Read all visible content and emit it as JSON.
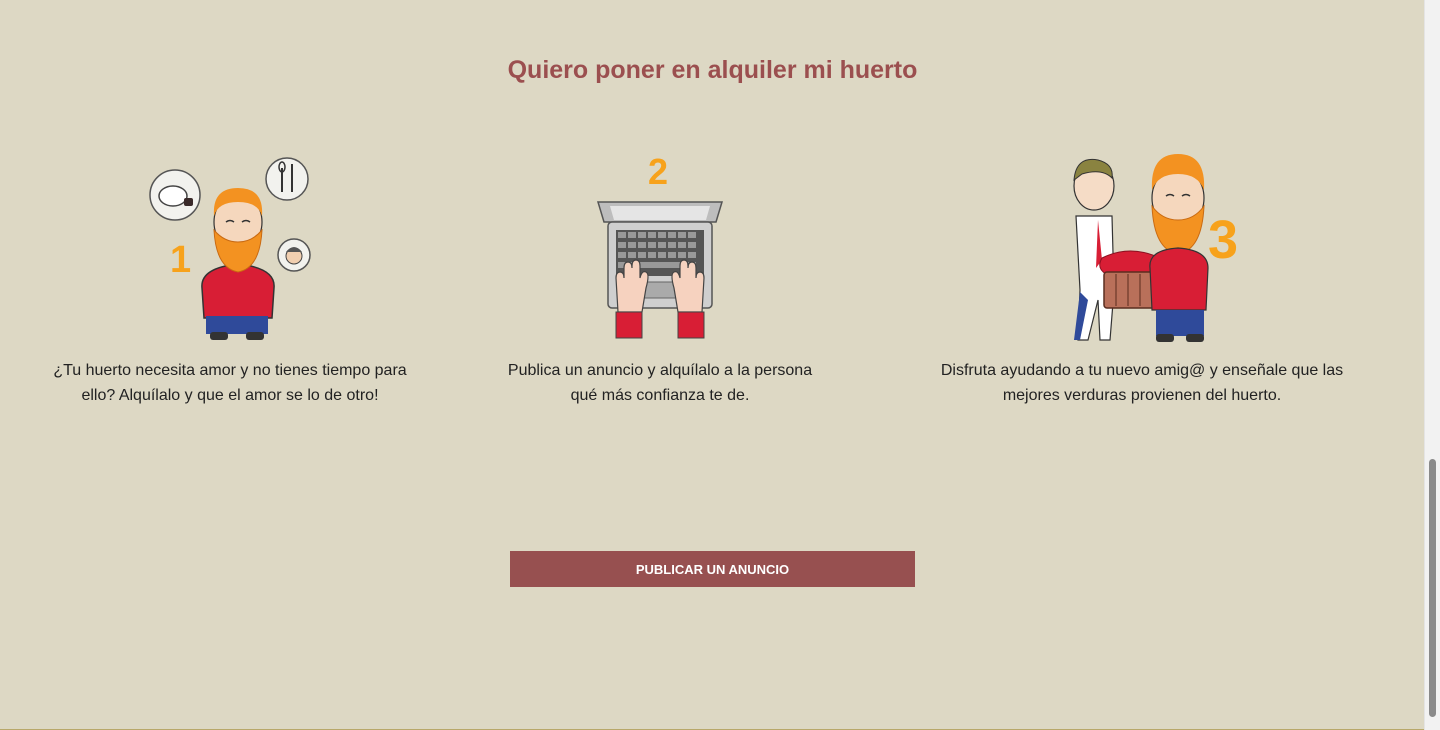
{
  "section": {
    "title": "Quiero poner en alquiler mi huerto"
  },
  "steps": [
    {
      "number": "1",
      "text_line1": "¿Tu huerto necesita amor y no tienes tiempo para",
      "text_line2": "ello? Alquílalo y que el amor se lo de otro!",
      "icon": "bearded-man-thinking-icon"
    },
    {
      "number": "2",
      "text_line1": "Publica un anuncio y alquílalo a la persona",
      "text_line2": "qué más confianza te de.",
      "icon": "laptop-typing-icon"
    },
    {
      "number": "3",
      "text_line1": "Disfruta ayudando a tu nuevo amig@ y enseñale que las",
      "text_line2": "mejores verduras provienen del huerto.",
      "icon": "two-men-vegetable-basket-icon"
    }
  ],
  "cta": {
    "label": "PUBLICAR UN ANUNCIO"
  },
  "colors": {
    "background": "#ddd8c4",
    "title": "#9b4f4f",
    "button": "#975050",
    "accent_orange": "#f7a21b",
    "shirt_red": "#d81e35"
  }
}
